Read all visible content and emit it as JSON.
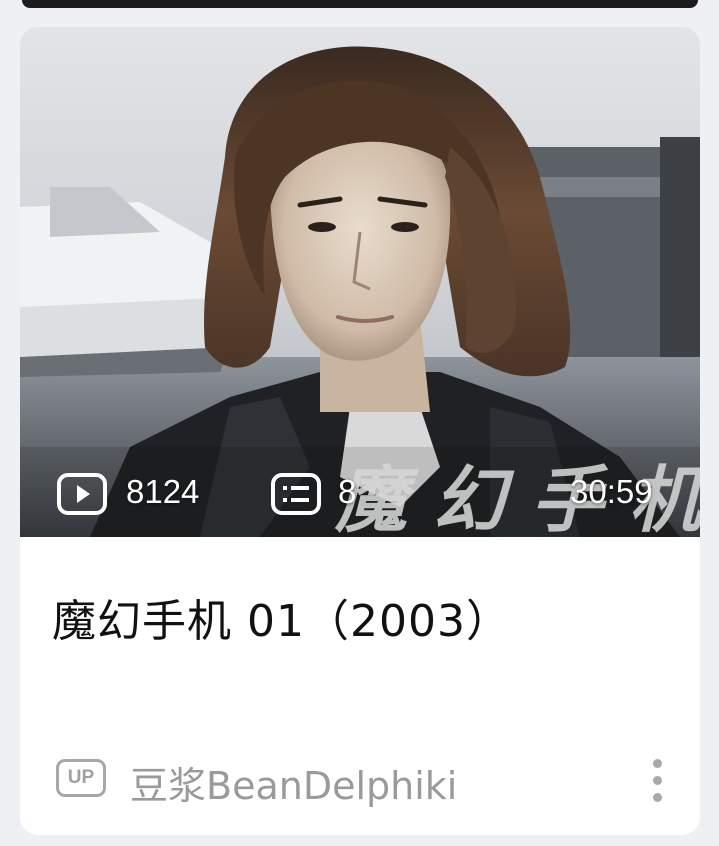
{
  "video": {
    "title": "魔幻手机 01（2003）",
    "thumbnail_overlay": "魔幻手机",
    "play_count": "8124",
    "comment_count": "8",
    "duration": "30:59"
  },
  "author": {
    "badge": "UP",
    "name": "豆浆BeanDelphiki"
  },
  "icons": {
    "play": "play-count-icon",
    "comments": "comment-list-icon",
    "more": "more-vertical-icon"
  },
  "colors": {
    "card_bg": "#ffffff",
    "page_bg": "#eef0f3",
    "title_text": "#111111",
    "meta_text": "#9a9a9a"
  }
}
